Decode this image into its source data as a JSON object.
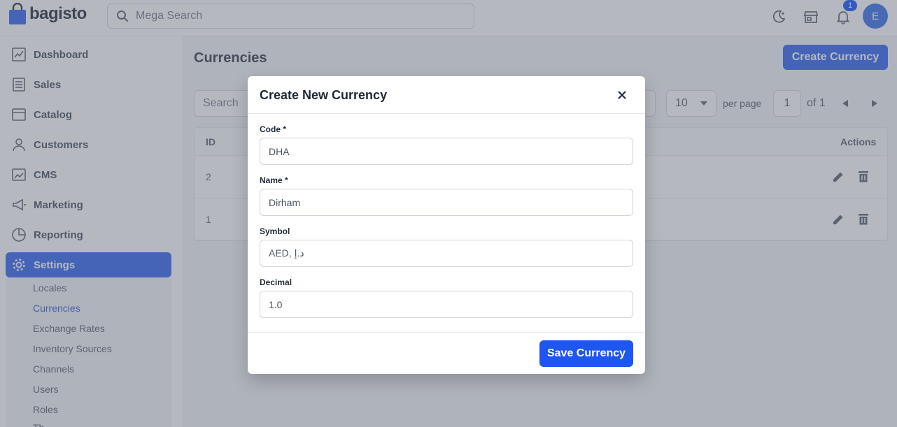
{
  "brand": {
    "name": "bagisto",
    "accent": "#1f56f0"
  },
  "header": {
    "search_placeholder": "Mega Search",
    "notification_count": "1",
    "avatar_initial": "E",
    "icons": [
      "dark-mode-icon",
      "storefront-icon",
      "bell-icon"
    ]
  },
  "sidebar": {
    "items": [
      {
        "label": "Dashboard",
        "icon": "dashboard-icon"
      },
      {
        "label": "Sales",
        "icon": "sales-icon"
      },
      {
        "label": "Catalog",
        "icon": "catalog-icon"
      },
      {
        "label": "Customers",
        "icon": "customers-icon"
      },
      {
        "label": "CMS",
        "icon": "cms-icon"
      },
      {
        "label": "Marketing",
        "icon": "marketing-icon"
      },
      {
        "label": "Reporting",
        "icon": "reporting-icon"
      },
      {
        "label": "Settings",
        "icon": "settings-icon"
      }
    ],
    "sub_items": [
      "Locales",
      "Currencies",
      "Exchange Rates",
      "Inventory Sources",
      "Channels",
      "Users",
      "Roles",
      "Th"
    ]
  },
  "main": {
    "title": "Currencies",
    "create_button": "Create Currency",
    "search_placeholder": "Search",
    "per_page_value": "10",
    "per_page_label": "per page",
    "page_value": "1",
    "page_of": "of 1",
    "columns": [
      "ID",
      "Actions"
    ],
    "rows": [
      {
        "id": "2"
      },
      {
        "id": "1"
      }
    ]
  },
  "modal": {
    "title": "Create New Currency",
    "fields": [
      {
        "label": "Code *",
        "value": "DHA"
      },
      {
        "label": "Name *",
        "value": "Dirham"
      },
      {
        "label": "Symbol",
        "value": "AED, د.إ"
      },
      {
        "label": "Decimal",
        "value": "1.0"
      }
    ],
    "save_button": "Save Currency"
  }
}
